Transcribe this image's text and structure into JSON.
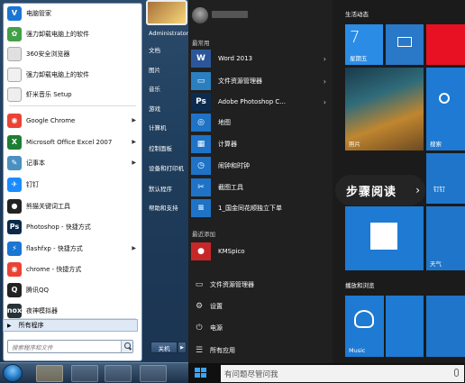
{
  "win7": {
    "programs": [
      {
        "label": "电脑管家",
        "color": "#1976d2",
        "glyph": "V",
        "arrow": false
      },
      {
        "label": "强力卸载电脑上的软件",
        "color": "#43a047",
        "glyph": "✿",
        "arrow": false
      },
      {
        "label": "360安全浏览器",
        "color": "#e0e0e0",
        "glyph": "",
        "arrow": false
      },
      {
        "label": "强力卸载电脑上的软件",
        "color": "#f0f0f0",
        "glyph": "",
        "arrow": false
      },
      {
        "label": "虾米音乐 Setup",
        "color": "#eeeeee",
        "glyph": "",
        "arrow": false
      },
      {
        "label": "Google Chrome",
        "color": "#ea4335",
        "glyph": "◉",
        "arrow": true
      },
      {
        "label": "Microsoft Office Excel 2007",
        "color": "#1e7e34",
        "glyph": "X",
        "arrow": true
      },
      {
        "label": "记事本",
        "color": "#4a90c2",
        "glyph": "✎",
        "arrow": true
      },
      {
        "label": "钉钉",
        "color": "#1a8cff",
        "glyph": "✈",
        "arrow": false
      },
      {
        "label": "熊猫关键词工具",
        "color": "#222222",
        "glyph": "●",
        "arrow": false
      },
      {
        "label": "Photoshop - 快捷方式",
        "color": "#0b2a4a",
        "glyph": "Ps",
        "arrow": false
      },
      {
        "label": "flashfxp - 快捷方式",
        "color": "#1976d2",
        "glyph": "⚡",
        "arrow": true
      },
      {
        "label": "chrome - 快捷方式",
        "color": "#ea4335",
        "glyph": "◉",
        "arrow": false
      },
      {
        "label": "腾讯QQ",
        "color": "#222222",
        "glyph": "Q",
        "arrow": false
      },
      {
        "label": "夜神模拟器",
        "color": "#263238",
        "glyph": "nox",
        "arrow": false
      }
    ],
    "all_programs": "所有程序",
    "search_placeholder": "搜索程序和文件",
    "right_items": [
      "Administrator",
      "文档",
      "图片",
      "音乐",
      "游戏",
      "计算机",
      "控制面板",
      "设备和打印机",
      "默认程序",
      "帮助和支持"
    ],
    "shutdown": "关机"
  },
  "win10": {
    "section_common": "最常用",
    "apps": [
      {
        "label": "Word 2013",
        "color": "#2b579a",
        "glyph": "W",
        "arrow": true
      },
      {
        "label": "文件资源管理器",
        "color": "#2a7fc0",
        "glyph": "▭",
        "arrow": true
      },
      {
        "label": "Adobe Photoshop C...",
        "color": "#0d2b4e",
        "glyph": "Ps",
        "arrow": true
      },
      {
        "label": "地图",
        "color": "#1f73c7",
        "glyph": "◎",
        "arrow": false
      },
      {
        "label": "计算器",
        "color": "#1f73c7",
        "glyph": "▦",
        "arrow": false
      },
      {
        "label": "闹钟和时钟",
        "color": "#1f73c7",
        "glyph": "◷",
        "arrow": false
      },
      {
        "label": "截图工具",
        "color": "#1f73c7",
        "glyph": "✂",
        "arrow": false
      },
      {
        "label": "1_国金同花顺独立下单",
        "color": "#1f73c7",
        "glyph": "≡",
        "arrow": false
      }
    ],
    "section_recent": "最近添加",
    "recent": [
      {
        "label": "KMSpico",
        "color": "#c62828",
        "glyph": "●"
      }
    ],
    "bottom": [
      {
        "label": "文件资源管理器",
        "icon": "folder-icon",
        "glyph": "▭"
      },
      {
        "label": "设置",
        "icon": "gear-icon",
        "glyph": "⚙"
      },
      {
        "label": "电源",
        "icon": "power-icon",
        "glyph": "⏻"
      },
      {
        "label": "所有应用",
        "icon": "list-icon",
        "glyph": "☰"
      }
    ],
    "group_life": "生活动态",
    "group_play": "播放和浏览",
    "calendar_day": "7",
    "calendar_weekday": "星期五",
    "tile_photos": "照片",
    "tile_search": "搜索",
    "tile_weather": "天气",
    "tile_music": "Music",
    "tile_dingding": "钉钉",
    "overlay": "步骤阅读",
    "search_bar": "有问题尽管问我"
  }
}
